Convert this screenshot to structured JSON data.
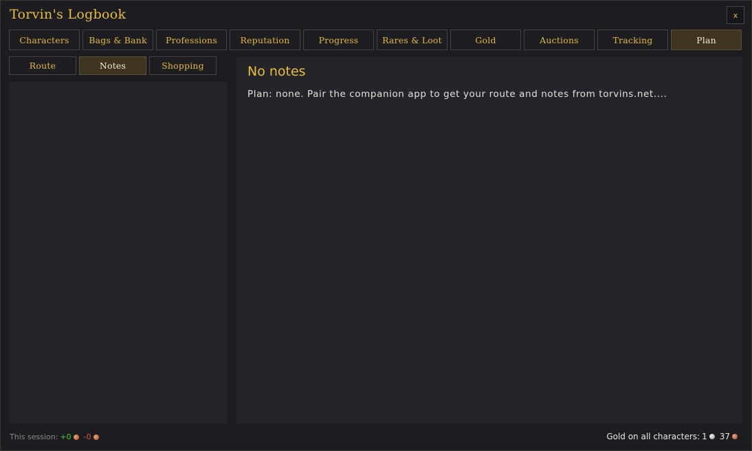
{
  "window": {
    "title": "Torvin's Logbook",
    "close_label": "x"
  },
  "main_tabs": [
    {
      "label": "Characters"
    },
    {
      "label": "Bags & Bank"
    },
    {
      "label": "Professions"
    },
    {
      "label": "Reputation"
    },
    {
      "label": "Progress"
    },
    {
      "label": "Rares & Loot"
    },
    {
      "label": "Gold"
    },
    {
      "label": "Auctions"
    },
    {
      "label": "Tracking"
    },
    {
      "label": "Plan"
    }
  ],
  "main_tabs_active": "Plan",
  "sub_tabs": [
    {
      "label": "Route"
    },
    {
      "label": "Notes"
    },
    {
      "label": "Shopping"
    }
  ],
  "sub_tabs_active": "Notes",
  "content": {
    "title": "No notes",
    "text": "Plan: none. Pair the companion app to get your route and notes from torvins.net...."
  },
  "footer": {
    "session_label": "This session:",
    "session_gain": "+0",
    "session_loss": "-0",
    "gold_label": "Gold on all characters:",
    "gold_amount": "1",
    "silver_amount": "37"
  },
  "colors": {
    "accent": "#e8bf3a",
    "panel": "#25242a",
    "active_tab": "#3d3520",
    "gain": "#38d23a",
    "loss": "#d65848"
  },
  "icons": {
    "close": "close-icon",
    "copper": "copper-coin-icon",
    "silver": "silver-coin-icon"
  }
}
